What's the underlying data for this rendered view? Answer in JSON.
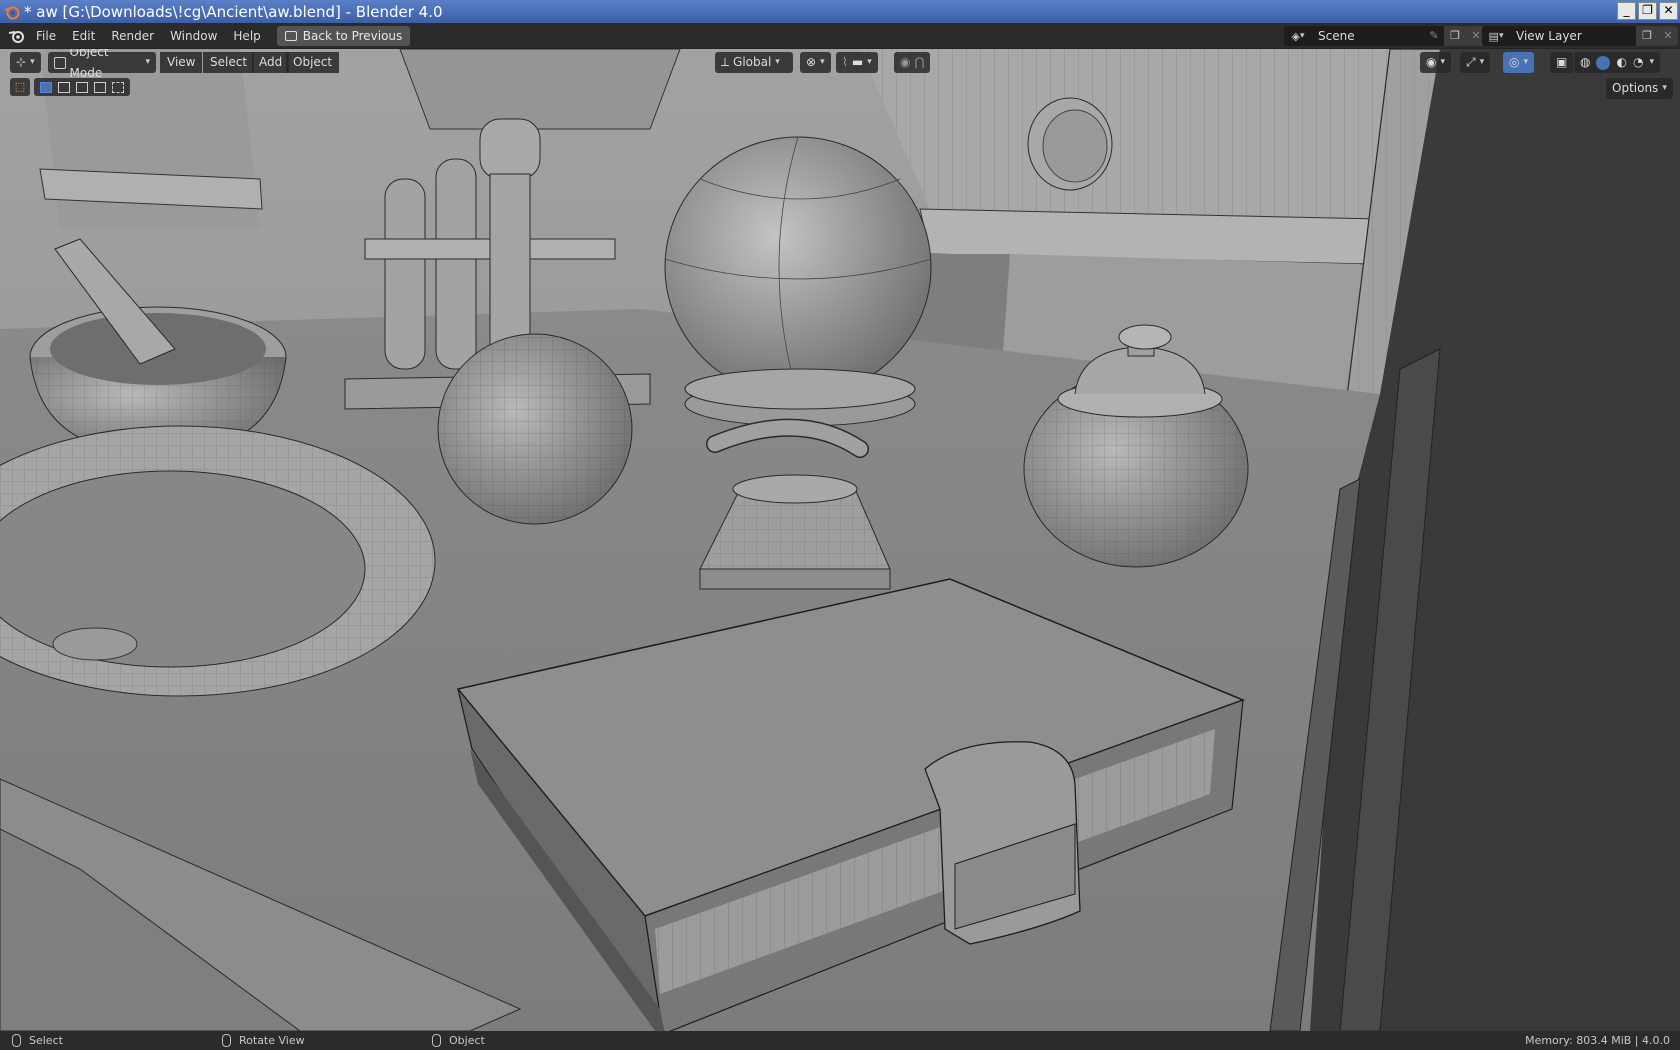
{
  "window": {
    "title": "* aw [G:\\Downloads\\!cg\\Ancient\\aw.blend] - Blender 4.0",
    "controls": [
      "_",
      "❐",
      "✕"
    ]
  },
  "topbar": {
    "menus": [
      "File",
      "Edit",
      "Render",
      "Window",
      "Help"
    ],
    "back_button": "Back to Previous",
    "scene_name": "Scene",
    "view_layer": "View Layer"
  },
  "viewport_header": {
    "mode": "Object Mode",
    "menus": [
      "View",
      "Select",
      "Add",
      "Object"
    ],
    "transform_orientation": "Global",
    "options_label": "Options"
  },
  "statusbar": {
    "left": "Select",
    "middle": "Rotate View",
    "right_action": "Object",
    "memory": "Memory: 803.4 MiB | 4.0.0"
  },
  "colors": {
    "accent": "#4772b3",
    "header_bg": "#2b2b2b",
    "viewport_bg": "#8a8a8a"
  }
}
